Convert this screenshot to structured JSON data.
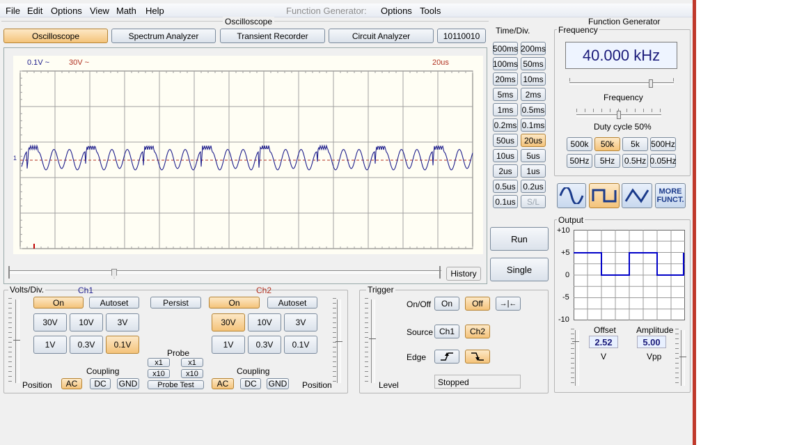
{
  "menu": {
    "file": "File",
    "edit": "Edit",
    "options": "Options",
    "view": "View",
    "math": "Math",
    "help": "Help",
    "fg_title": "Function Generator:",
    "fg_options": "Options",
    "fg_tools": "Tools"
  },
  "osc_section_title": "Oscilloscope",
  "tabs": {
    "oscilloscope": "Oscilloscope",
    "spectrum": "Spectrum Analyzer",
    "transient": "Transient Recorder",
    "circuit": "Circuit Analyzer",
    "binary": "10110010"
  },
  "scope": {
    "ch1_scale": "0.1V ~",
    "ch2_scale": "30V ~",
    "time_scale": "20us",
    "marker": "1",
    "history": "History"
  },
  "timediv": {
    "title": "Time/Div.",
    "buttons": [
      "500ms",
      "200ms",
      "100ms",
      "50ms",
      "20ms",
      "10ms",
      "5ms",
      "2ms",
      "1ms",
      "0.5ms",
      "0.2ms",
      "0.1ms",
      "50us",
      "20us",
      "10us",
      "5us",
      "2us",
      "1us",
      "0.5us",
      "0.2us",
      "0.1us",
      "S/L"
    ],
    "selected": "20us"
  },
  "run": "Run",
  "single": "Single",
  "volts": {
    "title": "Volts/Div.",
    "ch1": "Ch1",
    "ch2": "Ch2",
    "on": "On",
    "autoset": "Autoset",
    "persist": "Persist",
    "r1": [
      "30V",
      "10V",
      "3V"
    ],
    "r2": [
      "1V",
      "0.3V",
      "0.1V"
    ],
    "ch1_selected": "0.1V",
    "ch2_selected": "30V",
    "probe": "Probe",
    "x1": "x1",
    "x10": "x10",
    "probe_test": "Probe Test",
    "coupling": "Coupling",
    "ac": "AC",
    "dc": "DC",
    "gnd": "GND",
    "position": "Position"
  },
  "trigger": {
    "title": "Trigger",
    "onoff": "On/Off",
    "on": "On",
    "off": "Off",
    "source": "Source",
    "ch1": "Ch1",
    "ch2": "Ch2",
    "edge": "Edge",
    "level": "Level",
    "status": "Stopped",
    "center_symbol": "→|←"
  },
  "fg": {
    "title": "Function Generator",
    "freq_group": "Frequency",
    "readout": "40.000 kHz",
    "freq_label": "Frequency",
    "duty": "Duty cycle 50%",
    "ranges": [
      "500k",
      "50k",
      "5k",
      "500Hz",
      "50Hz",
      "5Hz",
      "0.5Hz",
      "0.05Hz"
    ],
    "range_selected": "50k",
    "more": "MORE FUNCT.",
    "more1": "MORE",
    "more2": "FUNCT.",
    "output": "Output",
    "yticks": [
      "+10",
      "+5",
      "0",
      "-5",
      "-10"
    ],
    "offset_label": "Offset",
    "offset_value": "2.52",
    "offset_unit": "V",
    "amp_label": "Amplitude",
    "amp_value": "5.00",
    "amp_unit": "Vpp"
  },
  "colors": {
    "ch1": "#1e1e8c",
    "ch2": "#b03020",
    "grid": "#808080",
    "scope_bg": "#ffffff"
  }
}
